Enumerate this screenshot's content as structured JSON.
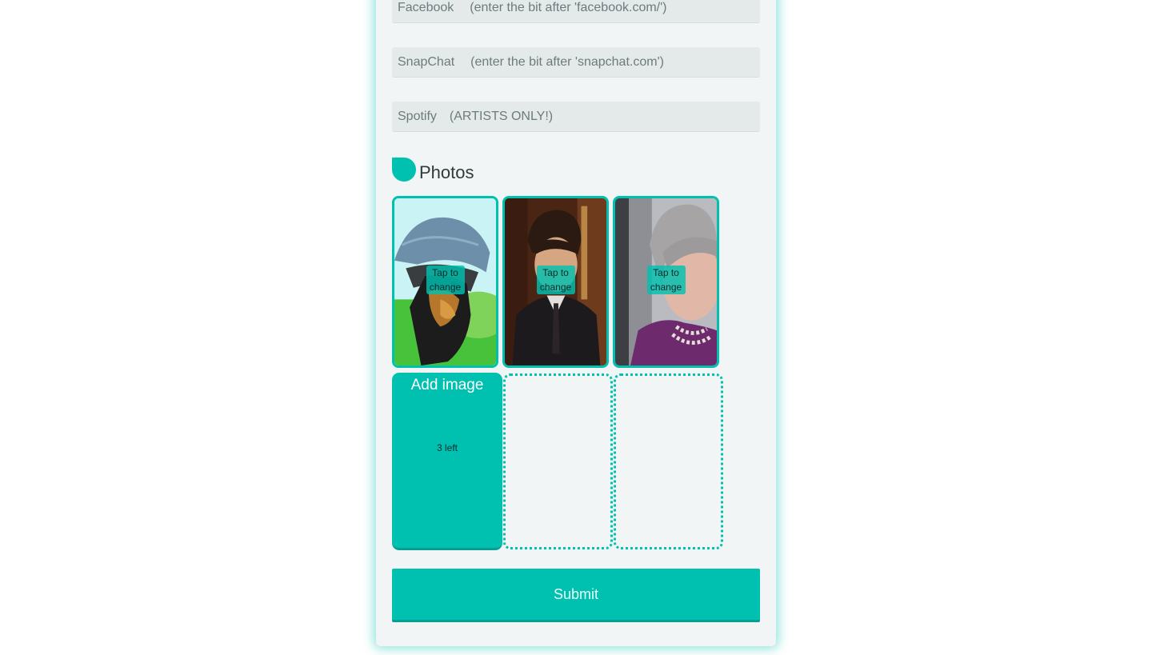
{
  "social_fields": [
    {
      "label": "Facebook",
      "placeholder": "(enter the bit after 'facebook.com/')",
      "value": ""
    },
    {
      "label": "SnapChat",
      "placeholder": "(enter the bit after 'snapchat.com')",
      "value": ""
    },
    {
      "label": "Spotify",
      "placeholder": "(ARTISTS ONLY!)",
      "value": ""
    }
  ],
  "photos_section": {
    "title": "Photos",
    "icon": "speech-bubble-icon",
    "photos": [
      {
        "overlay_text": "Tap to change",
        "subject": "dog-in-cap-photo"
      },
      {
        "overlay_text": "Tap to change",
        "subject": "man-in-suit-photo"
      },
      {
        "overlay_text": "Tap to change",
        "subject": "woman-portrait-photo"
      }
    ],
    "add_image": {
      "label": "Add image",
      "remaining_text": "3 left"
    },
    "empty_slots": 2
  },
  "submit_label": "Submit",
  "colors": {
    "accent": "#00c1b0",
    "accent_dark": "#089e91",
    "card_bg": "#f1f5f5",
    "field_bg": "#e4e9ea",
    "text_muted": "#6d7b7c"
  }
}
